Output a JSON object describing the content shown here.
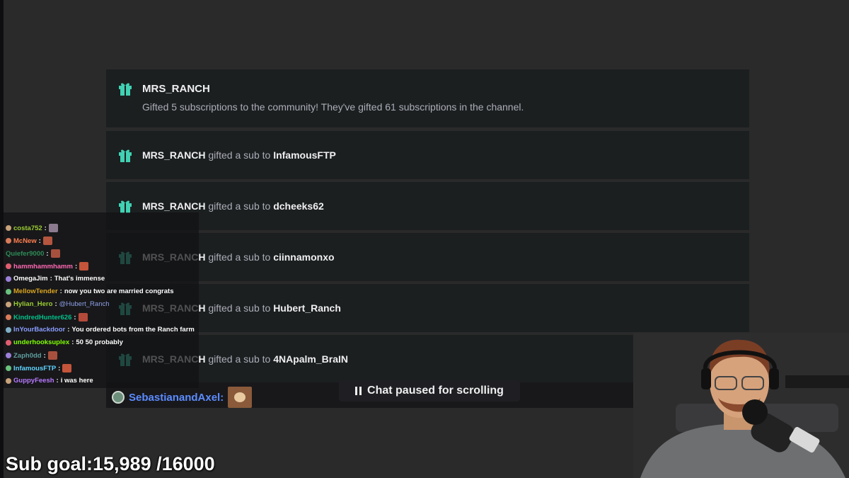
{
  "gifts": {
    "main": {
      "name": "MRS_RANCH",
      "description": "Gifted 5 subscriptions to the community! They've gifted 61 subscriptions in the channel."
    },
    "gifter": "MRS_RANCH",
    "connector": "gifted a sub to",
    "recipients": [
      "InfamousFTP",
      "dcheeks62",
      "ciinnamonxo",
      "Hubert_Ranch",
      "4NApalm_BraIN"
    ]
  },
  "footer": {
    "username": "SebastianandAxel:",
    "paused_label": "Chat paused for scrolling"
  },
  "chat": [
    {
      "user": "costa752",
      "text": "",
      "color": "#9acd32"
    },
    {
      "user": "McNew",
      "text": "",
      "color": "#ff7f50"
    },
    {
      "user": "Quiefer9000",
      "text": "",
      "color": "#2e8b57"
    },
    {
      "user": "hammhammhamm",
      "text": "",
      "color": "#ff69b4"
    },
    {
      "user": "OmegaJim",
      "text": "That's immense",
      "color": "#ffffff"
    },
    {
      "user": "MellowTender",
      "text": "now you two are married congrats",
      "color": "#daa520"
    },
    {
      "user": "Hylian_Hero",
      "text": "@Hubert_Ranch",
      "color": "#9acd32"
    },
    {
      "user": "KindredHunter626",
      "text": "",
      "color": "#00c08a"
    },
    {
      "user": "InYourBackdoor",
      "text": "You ordered bots from the Ranch farm",
      "color": "#8a9dff"
    },
    {
      "user": "underhooksuplex",
      "text": "50 50 probably",
      "color": "#7fff00"
    },
    {
      "user": "Zaph0dd",
      "text": "",
      "color": "#5f9ea0"
    },
    {
      "user": "InfamousFTP",
      "text": "",
      "color": "#5fd4ff"
    },
    {
      "user": "GuppyFeesh",
      "text": "i was here",
      "color": "#b77aff"
    }
  ],
  "sub_goal": {
    "label": "Sub goal:",
    "current": "15,989",
    "target": "/16000"
  },
  "colors": {
    "accent_gift": "#41d1b3",
    "card_bg": "#1b1f20",
    "page_bg": "#2a2a2b"
  }
}
